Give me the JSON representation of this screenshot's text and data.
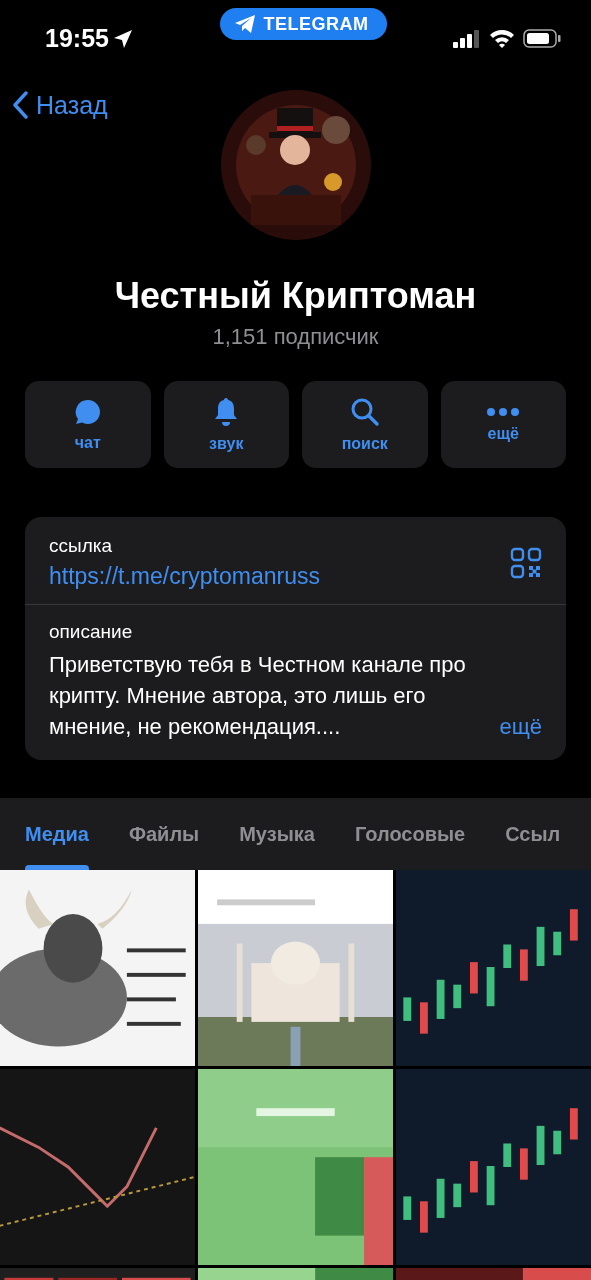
{
  "status_bar": {
    "time": "19:55",
    "app_pill": "TELEGRAM"
  },
  "nav": {
    "back": "Назад"
  },
  "channel": {
    "name": "Честный Криптоман",
    "subscribers": "1,151 подписчик"
  },
  "actions": [
    {
      "kind": "chat",
      "label": "чат"
    },
    {
      "kind": "sound",
      "label": "звук"
    },
    {
      "kind": "search",
      "label": "поиск"
    },
    {
      "kind": "more",
      "label": "ещё"
    }
  ],
  "info": {
    "link_label": "ссылка",
    "link": "https://t.me/cryptomanruss",
    "description_label": "описание",
    "description": "Приветствую тебя в Честном канале про крипту. Мнение автора, это лишь его мнение, не рекомендация....",
    "more": "ещё"
  },
  "tabs": [
    {
      "label": "Медиа",
      "selected": true
    },
    {
      "label": "Файлы",
      "selected": false
    },
    {
      "label": "Музыка",
      "selected": false
    },
    {
      "label": "Голосовые",
      "selected": false
    },
    {
      "label": "Ссыл",
      "selected": false
    }
  ]
}
